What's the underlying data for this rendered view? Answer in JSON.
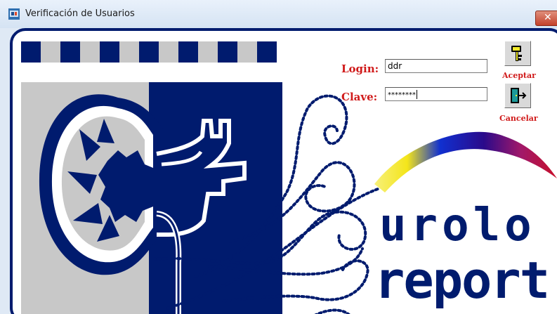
{
  "window": {
    "title": "Verificación de Usuarios",
    "close_symbol": "✕"
  },
  "form": {
    "login_label": "Login:",
    "login_value": "ddr",
    "clave_label": "Clave:",
    "clave_value": "********"
  },
  "buttons": {
    "aceptar_label": "Aceptar",
    "aceptar_icon": "key-icon",
    "cancelar_label": "Cancelar",
    "cancelar_icon": "exit-door-icon"
  },
  "brand": {
    "line1": "urolo",
    "line2": "report"
  },
  "colors": {
    "navy": "#001b6e",
    "accent_red": "#d01a1a",
    "gray": "#c8c8c8"
  }
}
